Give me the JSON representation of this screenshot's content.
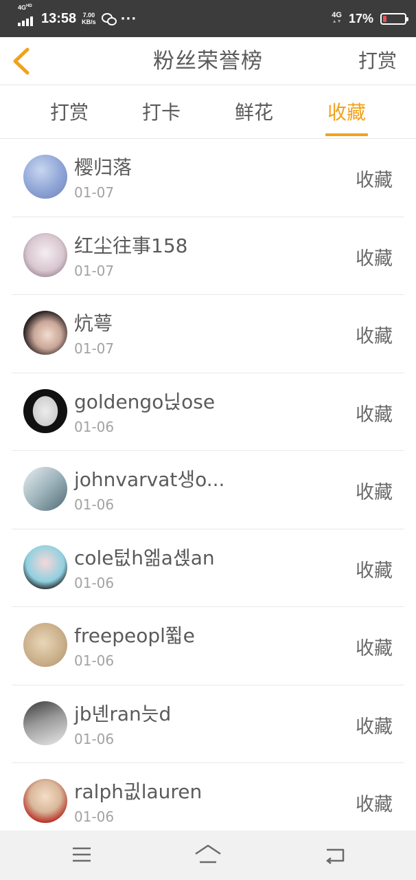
{
  "status_bar": {
    "signal_label": "4G",
    "signal_sub": "HD",
    "time": "13:58",
    "speed_value": "7.00",
    "speed_unit": "KB/s",
    "more": "···",
    "network": "4G",
    "battery_percent": "17%",
    "battery_level": 0.17,
    "battery_color": "#e8505b"
  },
  "header": {
    "back_icon": "chevron-left-icon",
    "title": "粉丝荣誉榜",
    "right_action": "打赏",
    "accent_color": "#f0a21e"
  },
  "tabs": [
    {
      "label": "打赏",
      "active": false
    },
    {
      "label": "打卡",
      "active": false
    },
    {
      "label": "鲜花",
      "active": false
    },
    {
      "label": "收藏",
      "active": true
    }
  ],
  "fans": [
    {
      "name": "樱归落",
      "date": "01-07",
      "action": "收藏"
    },
    {
      "name": "红尘往事158",
      "date": "01-07",
      "action": "收藏"
    },
    {
      "name": "炕萼",
      "date": "01-07",
      "action": "收藏"
    },
    {
      "name": "goldengo닍ose",
      "date": "01-06",
      "action": "收藏"
    },
    {
      "name": "johnvarvat생o...",
      "date": "01-06",
      "action": "收藏"
    },
    {
      "name": "cole텂h엚a셵an",
      "date": "01-06",
      "action": "收藏"
    },
    {
      "name": "freepeopl쮧e",
      "date": "01-06",
      "action": "收藏"
    },
    {
      "name": "jb녠ran늣d",
      "date": "01-06",
      "action": "收藏"
    },
    {
      "name": "ralph긦lauren",
      "date": "01-06",
      "action": "收藏"
    }
  ],
  "nav": {
    "menu_icon": "menu-icon",
    "home_icon": "home-icon",
    "back_icon": "back-icon"
  }
}
